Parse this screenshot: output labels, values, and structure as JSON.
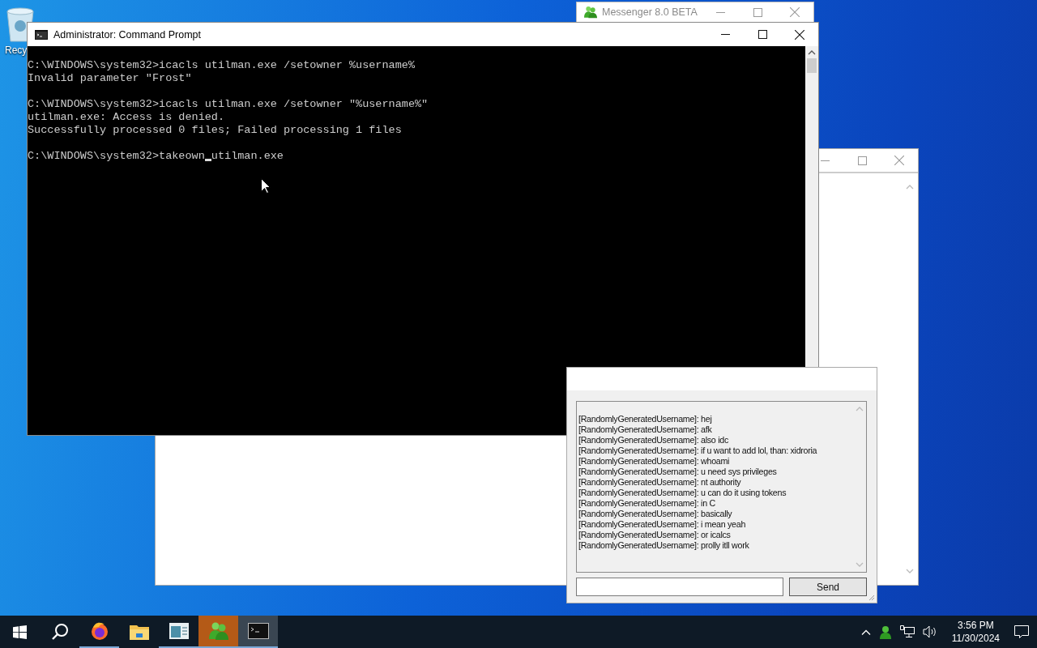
{
  "desktop": {
    "icons": [
      {
        "label": "Recy"
      }
    ]
  },
  "messenger_window": {
    "title": "Messenger 8.0 BETA"
  },
  "command_prompt": {
    "title": "Administrator: Command Prompt",
    "blocks": [
      [
        "C:\\WINDOWS\\system32>icacls utilman.exe /setowner %username%",
        "Invalid parameter \"Frost\""
      ],
      [
        "C:\\WINDOWS\\system32>icacls utilman.exe /setowner \"%username%\"",
        "utilman.exe: Access is denied.",
        "Successfully processed 0 files; Failed processing 1 files"
      ]
    ],
    "current_line": {
      "before_caret": "C:\\WINDOWS\\system32>takeown",
      "after_caret": "utilman.exe"
    }
  },
  "chat_window": {
    "messages": [
      "[RandomlyGeneratedUsername]: hej",
      "[RandomlyGeneratedUsername]: afk",
      "[RandomlyGeneratedUsername]: also idc",
      "[RandomlyGeneratedUsername]: if u want to add lol, than: xidroria",
      "[RandomlyGeneratedUsername]: whoami",
      "[RandomlyGeneratedUsername]: u need sys privileges",
      "[RandomlyGeneratedUsername]: nt authority",
      "[RandomlyGeneratedUsername]: u can do it using tokens",
      "[RandomlyGeneratedUsername]: in C",
      "[RandomlyGeneratedUsername]: basically",
      "[RandomlyGeneratedUsername]: i mean yeah",
      "[RandomlyGeneratedUsername]: or icalcs",
      "[RandomlyGeneratedUsername]: prolly itll work"
    ],
    "send_button": "Send"
  },
  "taskbar": {
    "items": [
      {
        "kind": "start",
        "running": false,
        "flashing": false,
        "selected": false
      },
      {
        "kind": "search",
        "running": false,
        "flashing": false,
        "selected": false
      },
      {
        "kind": "firefox",
        "running": true,
        "flashing": false,
        "selected": false
      },
      {
        "kind": "folder",
        "running": false,
        "flashing": false,
        "selected": false
      },
      {
        "kind": "app",
        "running": true,
        "flashing": false,
        "selected": false
      },
      {
        "kind": "messenger",
        "running": true,
        "flashing": true,
        "selected": false
      },
      {
        "kind": "console",
        "running": true,
        "flashing": false,
        "selected": true
      }
    ],
    "time": "3:56 PM",
    "date": "11/30/2024"
  }
}
